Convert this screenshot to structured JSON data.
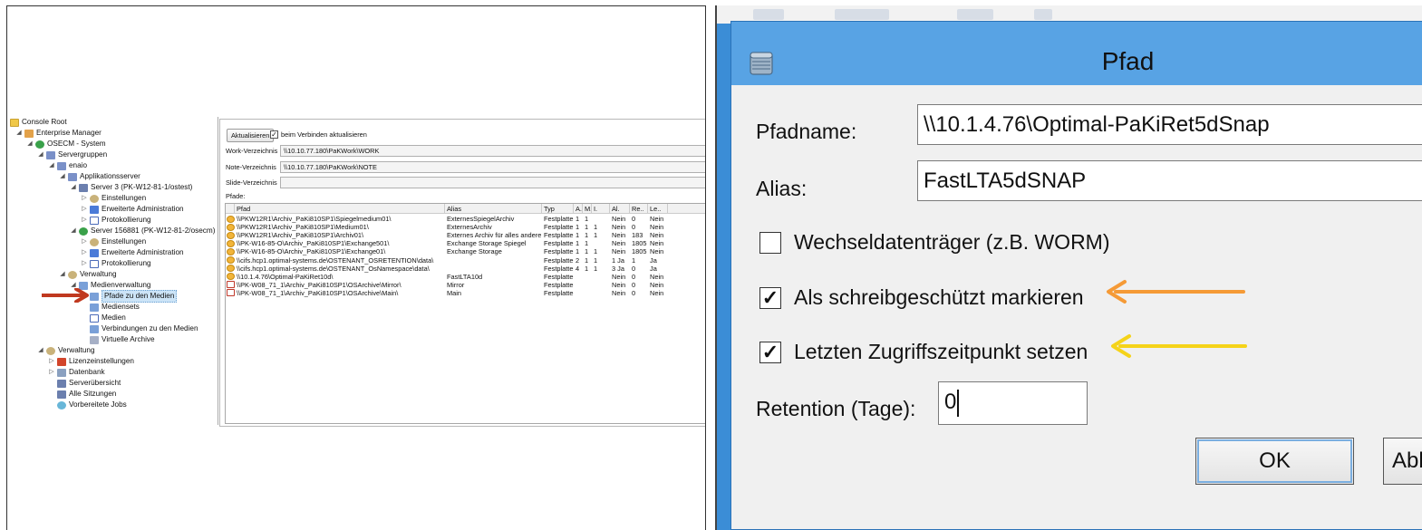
{
  "left_panel": {
    "tree": {
      "items": [
        {
          "label": "Console Root",
          "icon": "folder-icon"
        },
        {
          "label": "Enterprise Manager",
          "icon": "enterprise-manager-icon"
        },
        {
          "label": "OSECM - System",
          "icon": "system-icon"
        },
        {
          "label": "Servergruppen",
          "icon": "servergroups-icon"
        },
        {
          "label": "enaio",
          "icon": "group-icon"
        },
        {
          "label": "Applikationsserver",
          "icon": "appserver-icon"
        },
        {
          "label": "Server 3 (PK-W12-81-1/ostest)",
          "icon": "server-icon"
        },
        {
          "label": "Einstellungen",
          "icon": "settings-icon"
        },
        {
          "label": "Erweiterte Administration",
          "icon": "admin-icon"
        },
        {
          "label": "Protokollierung",
          "icon": "log-icon"
        },
        {
          "label": "Server 156881 (PK-W12-81-2/osecm)",
          "icon": "server-icon"
        },
        {
          "label": "Einstellungen",
          "icon": "settings-icon"
        },
        {
          "label": "Erweiterte Administration",
          "icon": "admin-icon"
        },
        {
          "label": "Protokollierung",
          "icon": "log-icon"
        },
        {
          "label": "Verwaltung",
          "icon": "gear-icon"
        },
        {
          "label": "Medienverwaltung",
          "icon": "media-management-icon"
        },
        {
          "label": "Pfade zu den Medien",
          "icon": "paths-icon"
        },
        {
          "label": "Mediensets",
          "icon": "mediasets-icon"
        },
        {
          "label": "Medien",
          "icon": "media-icon"
        },
        {
          "label": "Verbindungen zu den Medien",
          "icon": "connections-icon"
        },
        {
          "label": "Virtuelle Archive",
          "icon": "archive-icon"
        },
        {
          "label": "Verwaltung",
          "icon": "gear-icon"
        },
        {
          "label": "Lizenzeinstellungen",
          "icon": "license-icon"
        },
        {
          "label": "Datenbank",
          "icon": "database-icon"
        },
        {
          "label": "Serverübersicht",
          "icon": "server-overview-icon"
        },
        {
          "label": "Alle Sitzungen",
          "icon": "sessions-icon"
        },
        {
          "label": "Vorbereitete Jobs",
          "icon": "jobs-icon"
        }
      ]
    },
    "pane": {
      "refresh_button": "Aktualisieren",
      "auto_refresh_label": "beim Verbinden aktualisieren",
      "auto_refresh_checked": "✓",
      "fields": [
        {
          "label": "Work-Verzeichnis",
          "value": "\\\\10.10.77.180\\PaKWork\\WORK"
        },
        {
          "label": "Note-Verzeichnis",
          "value": "\\\\10.10.77.180\\PaKWork\\NOTE"
        },
        {
          "label": "Slide-Verzeichnis",
          "value": ""
        }
      ],
      "paths_label": "Pfade:",
      "columns": [
        "",
        "Pfad",
        "Alias",
        "Typ",
        "A.",
        "M.",
        "I.",
        "Al.",
        "Re..",
        "Le.."
      ],
      "rows": [
        {
          "status": "warn",
          "path": "\\\\PKW12R1\\Archiv_PaKi810SP1\\Spiegelmedium01\\",
          "alias": "ExternesSpiegelArchiv",
          "typ": "Festplatte",
          "a": "1",
          "m": "1",
          "i": "",
          "al": "Nein",
          "re": "0",
          "le": "Nein"
        },
        {
          "status": "warn",
          "path": "\\\\PKW12R1\\Archiv_PaKi810SP1\\Medium01\\",
          "alias": "ExternesArchiv",
          "typ": "Festplatte",
          "a": "1",
          "m": "1",
          "i": "1",
          "al": "Nein",
          "re": "0",
          "le": "Nein"
        },
        {
          "status": "warn",
          "path": "\\\\PKW12R1\\Archiv_PaKi810SP1\\Archiv01\\",
          "alias": "Externes Archiv für alles andere",
          "typ": "Festplatte",
          "a": "1",
          "m": "1",
          "i": "1",
          "al": "Nein",
          "re": "183",
          "le": "Nein"
        },
        {
          "status": "warn",
          "path": "\\\\PK-W16-85-O\\Archiv_PaKi810SP1\\Exchange501\\",
          "alias": "Exchange Storage Spiegel",
          "typ": "Festplatte",
          "a": "1",
          "m": "1",
          "i": "",
          "al": "Nein",
          "re": "1805",
          "le": "Nein"
        },
        {
          "status": "warn",
          "path": "\\\\PK-W16-85-O\\Archiv_PaKi810SP1\\Exchange01\\",
          "alias": "Exchange Storage",
          "typ": "Festplatte",
          "a": "1",
          "m": "1",
          "i": "1",
          "al": "Nein",
          "re": "1805",
          "le": "Nein"
        },
        {
          "status": "warn",
          "path": "\\\\cifs.hcp1.optimal-systems.de\\OSTENANT_OSRETENTION\\data\\",
          "alias": "",
          "typ": "Festplatte",
          "a": "2",
          "m": "1",
          "i": "1",
          "al": "1 Ja",
          "re": "1",
          "le": "Ja"
        },
        {
          "status": "warn",
          "path": "\\\\cifs.hcp1.optimal-systems.de\\OSTENANT_OsNamespace\\data\\",
          "alias": "",
          "typ": "Festplatte",
          "a": "4",
          "m": "1",
          "i": "1",
          "al": "3 Ja",
          "re": "0",
          "le": "Ja"
        },
        {
          "status": "warn",
          "path": "\\\\10.1.4.76\\Optimal-PaKiRet10d\\",
          "alias": "FastLTA10d",
          "typ": "Festplatte",
          "a": "",
          "m": "",
          "i": "",
          "al": "Nein",
          "re": "0",
          "le": "Nein"
        },
        {
          "status": "err",
          "path": "\\\\PK-W08_71_1\\Archiv_PaKi810SP1\\OSArchive\\Mirror\\",
          "alias": "Mirror",
          "typ": "Festplatte",
          "a": "",
          "m": "",
          "i": "",
          "al": "Nein",
          "re": "0",
          "le": "Nein"
        },
        {
          "status": "err",
          "path": "\\\\PK-W08_71_1\\Archiv_PaKi810SP1\\OSArchive\\Main\\",
          "alias": "Main",
          "typ": "Festplatte",
          "a": "",
          "m": "",
          "i": "",
          "al": "Nein",
          "re": "0",
          "le": "Nein"
        }
      ]
    }
  },
  "dialog": {
    "title": "Pfad",
    "pfadname_label": "Pfadname:",
    "pfadname_value": "\\\\10.1.4.76\\Optimal-PaKiRet5dSnap",
    "alias_label": "Alias:",
    "alias_value": "FastLTA5dSNAP",
    "checkboxes": [
      {
        "label": "Wechseldatenträger (z.B. WORM)",
        "mark": ""
      },
      {
        "label": "Als schreibgeschützt markieren",
        "mark": "✓"
      },
      {
        "label": "Letzten Zugriffszeitpunkt setzen",
        "mark": "✓"
      }
    ],
    "retention_label": "Retention (Tage):",
    "retention_value": "0",
    "ok_label": "OK",
    "cancel_label": "Abb",
    "colors": {
      "titlebar": "#58a3e4",
      "orange_arrow": "#f59a36",
      "yellow_arrow": "#f5d319",
      "red_arrow": "#c0391f"
    }
  }
}
